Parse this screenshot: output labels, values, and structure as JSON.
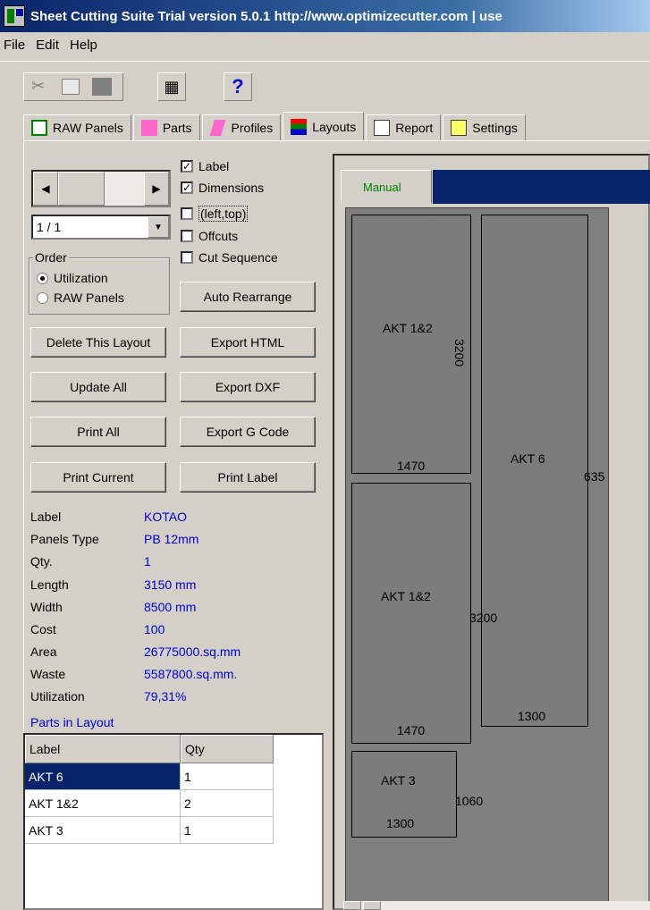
{
  "window": {
    "title": "Sheet Cutting Suite Trial version  5.0.1 http://www.optimizecutter.com | use"
  },
  "menu": [
    "File",
    "Edit",
    "Help"
  ],
  "toolbar": {
    "help_glyph": "?",
    "calculator_glyph": "▦"
  },
  "tabs": [
    "RAW Panels",
    "Parts",
    "Profiles",
    "Layouts",
    "Report",
    "Settings"
  ],
  "nav": {
    "page": "1 / 1",
    "left_arrow": "◀",
    "right_arrow": "▶",
    "dropdown_arrow": "▼"
  },
  "order": {
    "title": "Order",
    "options": [
      "Utilization",
      "RAW Panels"
    ],
    "selected": "Utilization"
  },
  "checks": [
    {
      "label": "Label",
      "checked": true
    },
    {
      "label": "Dimensions",
      "checked": true
    },
    {
      "label": "(left,top)",
      "checked": false
    },
    {
      "label": "Offcuts",
      "checked": false
    },
    {
      "label": "Cut Sequence",
      "checked": false
    }
  ],
  "buttons": {
    "auto_rearrange": "Auto Rearrange",
    "delete_layout": "Delete This Layout",
    "export_html": "Export HTML",
    "update_all": "Update All",
    "export_dxf": "Export DXF",
    "print_all": "Print All",
    "export_gcode": "Export G Code",
    "print_current": "Print Current",
    "print_label": "Print Label"
  },
  "info": [
    {
      "label": "Label",
      "value": "KOTAO"
    },
    {
      "label": "Panels Type",
      "value": "PB  12mm"
    },
    {
      "label": "Qty.",
      "value": "1"
    },
    {
      "label": "Length",
      "value": "3150 mm"
    },
    {
      "label": "Width",
      "value": "8500 mm"
    },
    {
      "label": "Cost",
      "value": "100"
    },
    {
      "label": "Area",
      "value": "26775000.sq.mm"
    },
    {
      "label": "Waste",
      "value": "5587800.sq.mm."
    },
    {
      "label": "Utilization",
      "value": "79,31%"
    }
  ],
  "parts_in_layout": {
    "title": "Parts in Layout",
    "columns": [
      "Label",
      "Qty"
    ],
    "rows": [
      {
        "label": "AKT 6",
        "qty": "1"
      },
      {
        "label": "AKT 1&2",
        "qty": "2"
      },
      {
        "label": "AKT 3",
        "qty": "1"
      }
    ]
  },
  "layout": {
    "subtab": "Manual",
    "parts": [
      {
        "label": "AKT 1&2",
        "width": "1470",
        "height": "3200"
      },
      {
        "label": "AKT 6",
        "width": "1300",
        "height": "635"
      },
      {
        "label": "AKT 1&2",
        "width": "1470",
        "height": "3200"
      },
      {
        "label": "AKT 3",
        "width": "1300",
        "height": "1060"
      }
    ]
  }
}
